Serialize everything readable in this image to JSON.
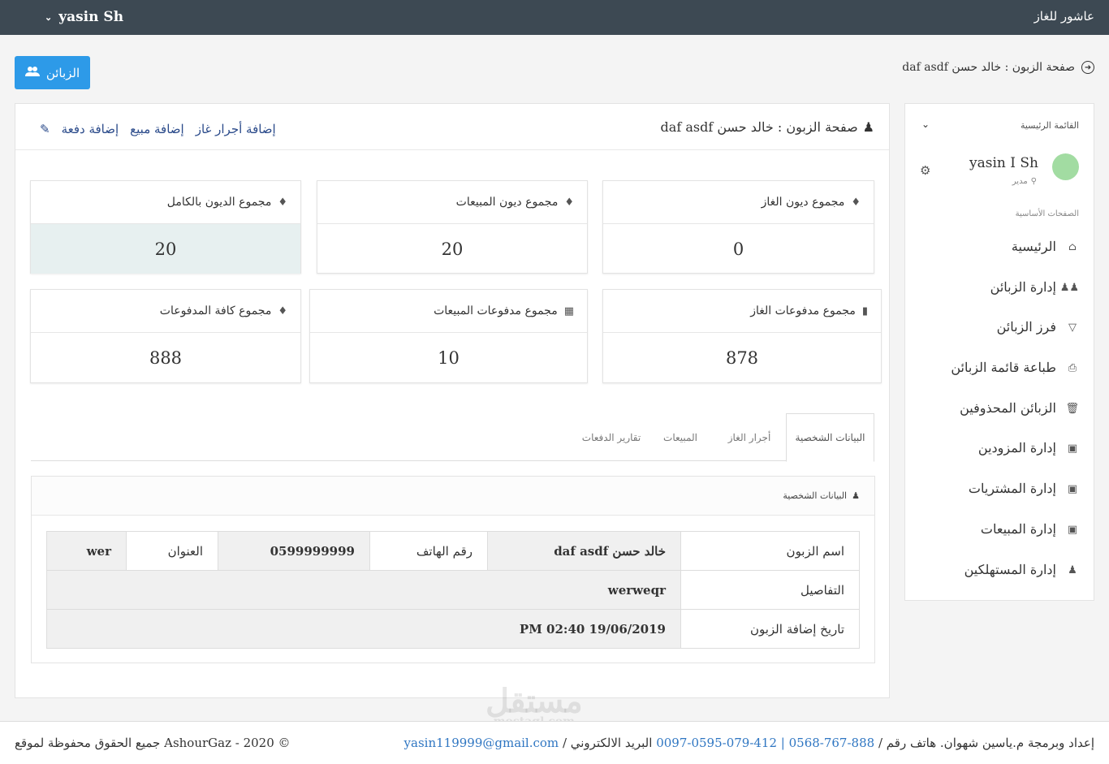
{
  "topbar": {
    "brand": "عاشور للغاز",
    "user": "yasin Sh"
  },
  "header": {
    "customers_button": "الزبائن",
    "breadcrumb": "صفحة الزبون : خالد حسن daf asdf"
  },
  "sidebar": {
    "menu_title": "القائمة الرئيسية",
    "user_name": "yasin I Sh",
    "user_role": "مدير",
    "section_label": "الصفحات الأساسية",
    "items": [
      {
        "label": "الرئيسية",
        "icon": "home-icon"
      },
      {
        "label": "إدارة الزبائن",
        "icon": "users-icon"
      },
      {
        "label": "فرز الزبائن",
        "icon": "filter-icon"
      },
      {
        "label": "طباعة قائمة الزبائن",
        "icon": "print-icon"
      },
      {
        "label": "الزبائن المحذوفين",
        "icon": "trash-icon"
      },
      {
        "label": "إدارة المزودين",
        "icon": "gift-icon"
      },
      {
        "label": "إدارة المشتريات",
        "icon": "gift-icon"
      },
      {
        "label": "إدارة المبيعات",
        "icon": "gift-icon"
      },
      {
        "label": "إدارة المستهلكين",
        "icon": "user-edit-icon"
      }
    ]
  },
  "main": {
    "title": "صفحة الزبون : خالد حسن daf asdf",
    "actions": {
      "add_gas_fee": "إضافة أجرار غاز",
      "add_sale": "إضافة مبيع",
      "add_payment": "إضافة دفعة"
    }
  },
  "stats": {
    "total_debts": {
      "label": "مجموع الديون بالكامل",
      "value": "20",
      "icon": "tags-icon"
    },
    "sales_debts": {
      "label": "مجموع ديون المبيعات",
      "value": "20",
      "icon": "tags-icon"
    },
    "gas_debts": {
      "label": "مجموع ديون الغاز",
      "value": "0",
      "icon": "tags-icon"
    },
    "all_payments": {
      "label": "مجموع كافة المدفوعات",
      "value": "888",
      "icon": "tags-icon"
    },
    "sales_payments": {
      "label": "مجموع مدفوعات المبيعات",
      "value": "10",
      "icon": "calendar-icon"
    },
    "gas_payments": {
      "label": "مجموع مدفوعات الغاز",
      "value": "878",
      "icon": "bottle-icon"
    }
  },
  "tabs": [
    {
      "label": "البيانات الشخصية",
      "active": true
    },
    {
      "label": "أجرار الغاز",
      "active": false
    },
    {
      "label": "المبيعات",
      "active": false
    },
    {
      "label": "تقارير الدفعات",
      "active": false
    }
  ],
  "personal": {
    "panel_title": "البيانات الشخصية",
    "name_label": "اسم الزبون",
    "name_value": "خالد حسن daf asdf",
    "phone_label": "رقم الهاتف",
    "phone_value": "0599999999",
    "address_label": "العنوان",
    "address_value": "wer",
    "details_label": "التفاصيل",
    "details_value": "werweqr",
    "added_label": "تاريخ إضافة الزبون",
    "added_value": "PM 02:40 19/06/2019"
  },
  "footer": {
    "credits_prefix": "إعداد وبرمجة م.ياسين شهوان. هاتف رقم /",
    "phones": "0097-0595-079-412 | 0568-767-888",
    "email_prefix": "البريد الالكتروني /",
    "email": "yasin119999@gmail.com",
    "copyright": "جميع الحقوق محفوظة لموقع AshourGaz - 2020 ©"
  },
  "watermark": {
    "text": "مستقل",
    "sub": "mostaql.com"
  },
  "colors": {
    "topbar": "#3d4953",
    "accent": "#2d9ae8",
    "highlight": "#e7f0f0"
  }
}
